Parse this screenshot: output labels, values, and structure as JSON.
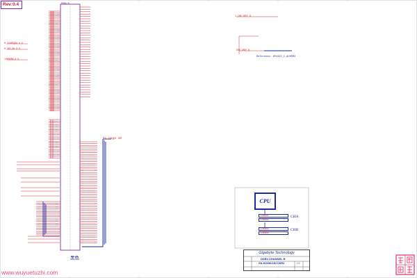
{
  "sheet": {
    "rev_label": "Rev:0.4",
    "chip_title": "黑色",
    "watermark": "www.wuyuetuzhi.com",
    "cpu_label": "CPU",
    "dimms": [
      "DIMM1",
      "DIMM2",
      "DIMM3",
      "DIMM4"
    ],
    "channels": [
      "CHA",
      "CHB"
    ]
  },
  "title_block": {
    "company": "Gigabyte Technology",
    "title": "DDR4 CHANNEL B",
    "model": "GA-H110M-DS2 DDR3",
    "rev": "1.0"
  },
  "annotations": {
    "to_page": "To page 10",
    "reference_note": "Reference: XP4322_C_ALMOR4",
    "left_nets": [
      "M_CLKREQB# 0 0",
      "M_CKE_B# 0 0",
      "CKMDDRB 0 0"
    ],
    "right_net": "1_CHB_VREF_B",
    "right_net2": "DDR_VREF_B"
  },
  "colors": {
    "wire_red": "#d0283a",
    "wire_blue": "#1a2a9a",
    "pin_text": "#6a1a8a",
    "brand_text": "#1a2a9a",
    "watermark": "#e84b7a"
  },
  "icons": {
    "logo": "stamp-logo-icon"
  }
}
